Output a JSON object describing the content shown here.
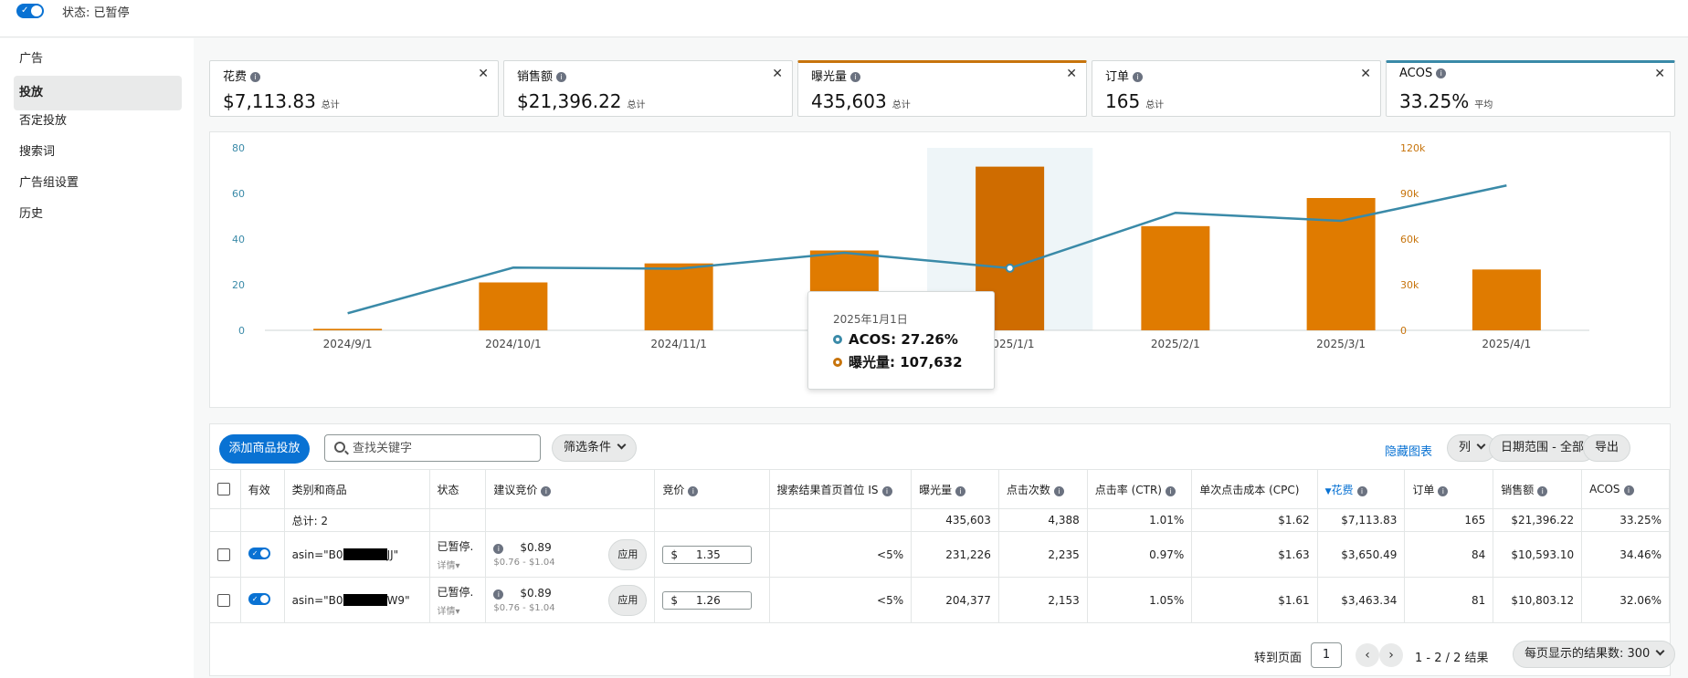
{
  "header": {
    "status_label": "状态: 已暂停"
  },
  "sidebar": {
    "items": [
      {
        "label": "广告",
        "active": false
      },
      {
        "label": "投放",
        "active": true
      },
      {
        "label": "否定投放",
        "active": false
      },
      {
        "label": "搜索词",
        "active": false
      },
      {
        "label": "广告组设置",
        "active": false
      },
      {
        "label": "历史",
        "active": false
      }
    ]
  },
  "metrics": [
    {
      "name": "花费",
      "value": "$7,113.83",
      "sub": "总计",
      "selected": false
    },
    {
      "name": "销售额",
      "value": "$21,396.22",
      "sub": "总计",
      "selected": false
    },
    {
      "name": "曝光量",
      "value": "435,603",
      "sub": "总计",
      "selected": true,
      "color": "#c7740c"
    },
    {
      "name": "订单",
      "value": "165",
      "sub": "总计",
      "selected": false
    },
    {
      "name": "ACOS",
      "value": "33.25%",
      "sub": "平均",
      "selected": true,
      "color": "#3a8aa8"
    }
  ],
  "chart_data": {
    "type": "bar",
    "categories": [
      "2024/9/1",
      "2024/10/1",
      "2024/11/1",
      "2024/12/1",
      "2025/1/1",
      "2025/2/1",
      "2025/3/1",
      "2025/4/1"
    ],
    "x_tick_labels": [
      "2024/9/1",
      "2024/10/1",
      "2024/11/1",
      "",
      "2025/1/1",
      "2025/2/1",
      "2025/3/1",
      "2025/4/1"
    ],
    "series": [
      {
        "name": "曝光量",
        "kind": "bar",
        "axis": "right",
        "color": "#e07b00",
        "values": [
          1000,
          31500,
          44000,
          52500,
          107632,
          68500,
          87000,
          40000
        ]
      },
      {
        "name": "ACOS",
        "kind": "line",
        "axis": "left",
        "color": "#3a8aa8",
        "values": [
          7.5,
          27.5,
          27.0,
          34.0,
          27.26,
          51.5,
          48.0,
          63.5
        ]
      }
    ],
    "left_axis": {
      "ylim": [
        0,
        80
      ],
      "ticks": [
        "0",
        "20",
        "40",
        "60",
        "80"
      ],
      "color": "#3a8aa8"
    },
    "right_axis": {
      "ylim": [
        0,
        120000
      ],
      "ticks": [
        "0",
        "30k",
        "60k",
        "90k",
        "120k"
      ],
      "color": "#c7740c"
    },
    "highlight_index": 4,
    "tooltip": {
      "date": "2025年1月1日",
      "acos": "ACOS: 27.26%",
      "impressions": "曝光量: 107,632"
    }
  },
  "toolbar": {
    "add_button": "添加商品投放",
    "search_placeholder": "查找关键字",
    "filter": "筛选条件",
    "hide_chart": "隐藏图表",
    "columns": "列",
    "date_range": "日期范围 - 全部",
    "export": "导出"
  },
  "table": {
    "headers": [
      "有效",
      "类别和商品",
      "状态",
      "建议竞价",
      "竞价",
      "搜索结果首页首位 IS",
      "曝光量",
      "点击次数",
      "点击率 (CTR)",
      "单次点击成本 (CPC)",
      "花费",
      "订单",
      "销售额",
      "ACOS"
    ],
    "total": {
      "label": "总计: 2",
      "impressions": "435,603",
      "clicks": "4,388",
      "ctr": "1.01%",
      "cpc": "$1.62",
      "spend": "$7,113.83",
      "orders": "165",
      "sales": "$21,396.22",
      "acos": "33.25%"
    },
    "rows": [
      {
        "asin_prefix": "asin=\"B0",
        "asin_suffix": "JJ\"",
        "status": "已暂停.",
        "detail": "详情",
        "sugg_bid": "$0.89",
        "sugg_range": "$0.76 - $1.04",
        "apply": "应用",
        "currency": "$",
        "bid": "1.35",
        "is_share": "<5%",
        "impressions": "231,226",
        "clicks": "2,235",
        "ctr": "0.97%",
        "cpc": "$1.63",
        "spend": "$3,650.49",
        "orders": "84",
        "sales": "$10,593.10",
        "acos": "34.46%"
      },
      {
        "asin_prefix": "asin=\"B0",
        "asin_suffix": "W9\"",
        "status": "已暂停.",
        "detail": "详情",
        "sugg_bid": "$0.89",
        "sugg_range": "$0.76 - $1.04",
        "apply": "应用",
        "currency": "$",
        "bid": "1.26",
        "is_share": "<5%",
        "impressions": "204,377",
        "clicks": "2,153",
        "ctr": "1.05%",
        "cpc": "$1.61",
        "spend": "$3,463.34",
        "orders": "81",
        "sales": "$10,803.12",
        "acos": "32.06%"
      }
    ]
  },
  "pagination": {
    "goto_label": "转到页面",
    "page": "1",
    "range": "1 - 2 / 2 结果",
    "per_page": "每页显示的结果数: 300"
  }
}
